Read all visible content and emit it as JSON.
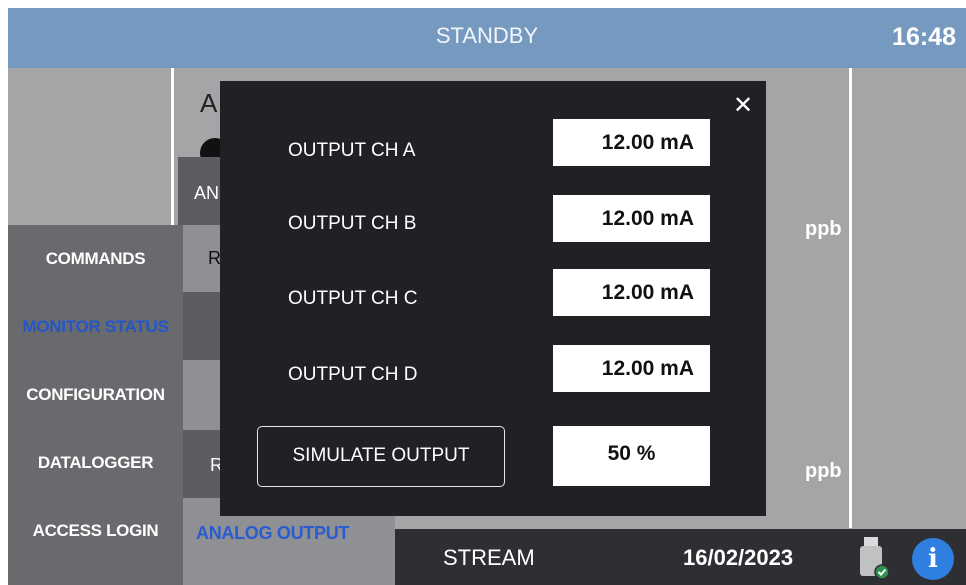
{
  "header": {
    "status": "STANDBY",
    "time": "16:48"
  },
  "background": {
    "analysis_heading_fragment": "A",
    "analog_tile_fragment": "AN",
    "row_fragments": [
      "R",
      "R"
    ],
    "units": [
      "ppb",
      "ppb"
    ]
  },
  "sidebar": {
    "items": [
      {
        "label": "COMMANDS",
        "active": false
      },
      {
        "label": "MONITOR STATUS",
        "active": true
      },
      {
        "label": "CONFIGURATION",
        "active": false
      },
      {
        "label": "DATALOGGER",
        "active": false
      },
      {
        "label": "ACCESS LOGIN",
        "active": false
      }
    ],
    "active_submenu": "ANALOG OUTPUT",
    "active_color": "#2456c9"
  },
  "footer": {
    "mode": "STREAM",
    "date": "16/02/2023",
    "icons": [
      "usb-drive-icon",
      "info-icon"
    ]
  },
  "modal": {
    "close_icon": "close-icon",
    "channels": [
      {
        "label": "OUTPUT CH A",
        "value": "12.00 mA"
      },
      {
        "label": "OUTPUT CH B",
        "value": "12.00 mA"
      },
      {
        "label": "OUTPUT CH C",
        "value": "12.00 mA"
      },
      {
        "label": "OUTPUT CH D",
        "value": "12.00 mA"
      }
    ],
    "simulate_button": "SIMULATE OUTPUT",
    "simulate_value": "50 %"
  },
  "colors": {
    "header_bg": "#7599bf",
    "modal_bg": "#1f2124",
    "accent_blue": "#2a5bd3",
    "info_blue": "#2f7fe0"
  }
}
